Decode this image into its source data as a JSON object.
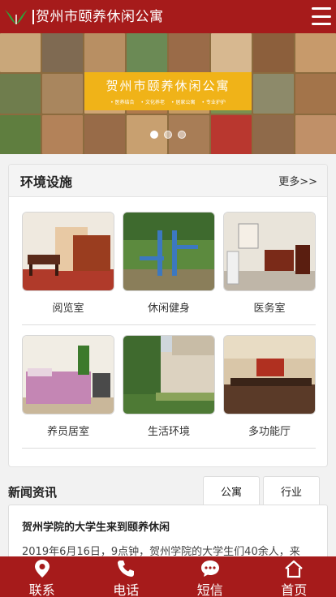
{
  "header": {
    "title": "贺州市颐养休闲公寓",
    "logo_icon": "leaf-logo-icon",
    "menu_icon": "hamburger-menu-icon"
  },
  "banner": {
    "title": "贺州市颐养休闲公寓",
    "subtitles": [
      "• 医养结合",
      "• 文化养老",
      "• 居家公寓",
      "• 专业护护"
    ],
    "slides": 3,
    "active_slide": 1
  },
  "facilities": {
    "title": "环境设施",
    "more": "更多>>",
    "items": [
      {
        "label": "阅览室"
      },
      {
        "label": "休闲健身"
      },
      {
        "label": "医务室"
      },
      {
        "label": "养员居室"
      },
      {
        "label": "生活环境"
      },
      {
        "label": "多功能厅"
      }
    ]
  },
  "news": {
    "title": "新闻资讯",
    "tabs": [
      {
        "label": "公寓"
      },
      {
        "label": "行业"
      }
    ],
    "article": {
      "headline": "贺州学院的大学生来到颐养休闲",
      "snippet": "2019年6月16日，9点钟，贺州学院的大学生们40余人，来"
    }
  },
  "bottom_nav": [
    {
      "label": "联系",
      "icon": "location-pin-icon"
    },
    {
      "label": "电话",
      "icon": "phone-icon"
    },
    {
      "label": "短信",
      "icon": "chat-bubble-icon"
    },
    {
      "label": "首页",
      "icon": "home-icon"
    }
  ],
  "colors": {
    "brand": "#a61b1b",
    "banner_box": "#f0b318"
  }
}
